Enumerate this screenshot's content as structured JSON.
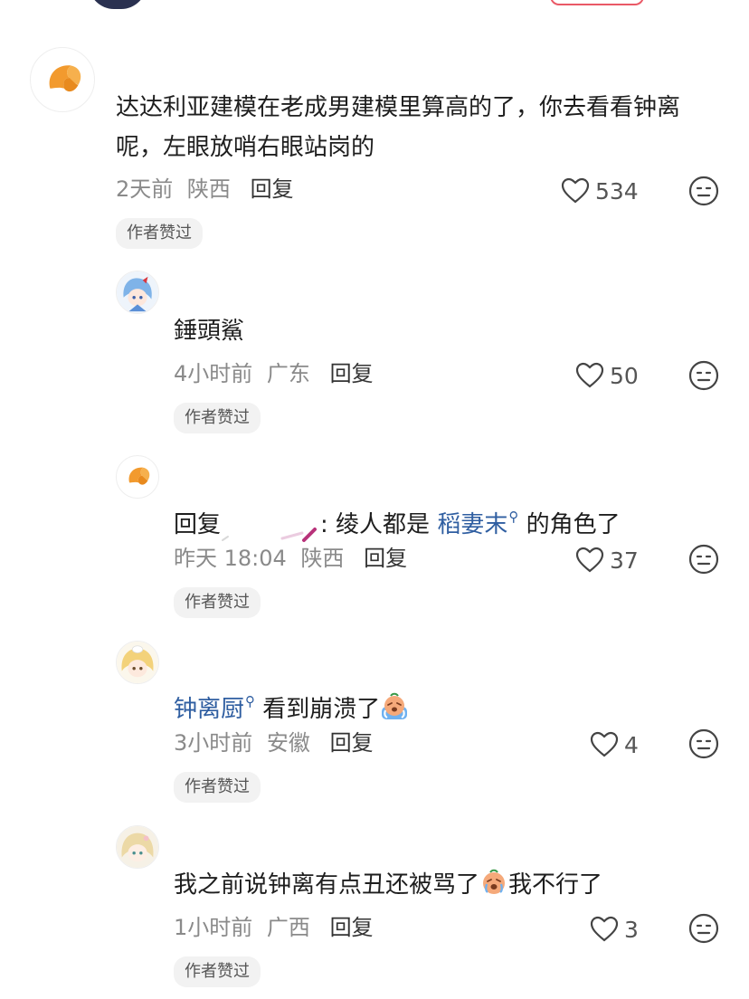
{
  "comments": [
    {
      "text_line1": "达达利亚建模在老成男建模里算高的了，你去看看钟离",
      "text_line2": "呢，左眼放哨右眼站岗的",
      "time": "2天前",
      "location": "陕西",
      "reply_label": "回复",
      "likes": "534",
      "tag": "作者赞过",
      "avatar_icon": "croissant-icon"
    },
    {
      "text": "錘頭鯊",
      "time": "4小时前",
      "location": "广东",
      "reply_label": "回复",
      "likes": "50",
      "tag": "作者赞过",
      "avatar_icon": "anime-girl-blue-hair"
    },
    {
      "prefix": "回复",
      "sep": ": 绫人都是 ",
      "link": "稻妻末",
      "suffix": " 的角色了",
      "time": "昨天 18:04",
      "location": "陕西",
      "reply_label": "回复",
      "likes": "37",
      "tag": "作者赞过",
      "avatar_icon": "croissant-icon"
    },
    {
      "link": "钟离厨",
      "text": " 看到崩溃了",
      "time": "3小时前",
      "location": "安徽",
      "reply_label": "回复",
      "likes": "4",
      "tag": "作者赞过",
      "avatar_icon": "anime-girl-blonde"
    },
    {
      "text_a": "我之前说钟离有点丑还被骂了",
      "text_b": "我不行了",
      "time": "1小时前",
      "location": "广西",
      "reply_label": "回复",
      "likes": "3",
      "tag": "作者赞过",
      "avatar_icon": "anime-girl-light-hair"
    }
  ],
  "colors": {
    "link": "#2f5ea1",
    "meta": "#8a8a8a",
    "tag_bg": "#f2f2f2"
  }
}
